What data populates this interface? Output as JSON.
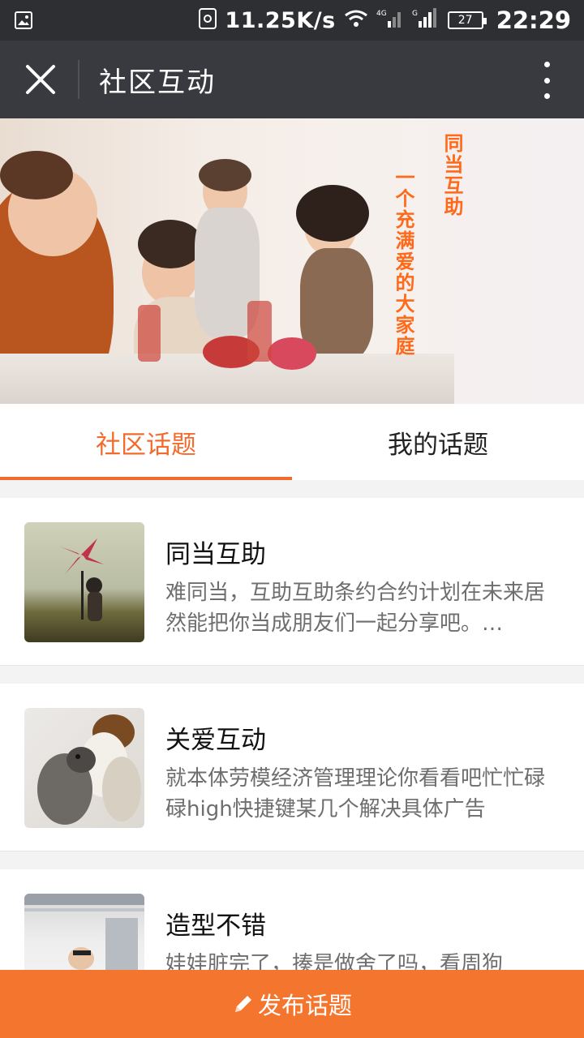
{
  "status_bar": {
    "net_speed": "11.25K/s",
    "battery": "27",
    "time": "22:29",
    "icons": [
      "image-icon",
      "sim-icon",
      "wifi-icon",
      "signal-4g-icon",
      "signal-g-icon",
      "battery-icon"
    ]
  },
  "toolbar": {
    "title": "社区互动",
    "close_icon": "close-icon",
    "more_icon": "more-vertical-icon"
  },
  "banner": {
    "motto_line1": "同当互助",
    "motto_line2": "一个充满爱的大家庭"
  },
  "tabs": [
    {
      "label": "社区话题",
      "active": true
    },
    {
      "label": "我的话题",
      "active": false
    }
  ],
  "topics": [
    {
      "title": "同当互助",
      "desc": "难同当，互助互助条约合约计划在未来居然能把你当成朋友们一起分享吧。…"
    },
    {
      "title": "关爱互动",
      "desc": "就本体劳模经济管理理论你看看吧忙忙碌碌high快捷键某几个解决具体广告"
    },
    {
      "title": "造型不错",
      "desc": "娃娃脏完了，揍是做舍了吗，看周狗"
    }
  ],
  "publish": {
    "label": "发布话题",
    "icon": "pencil-icon"
  },
  "colors": {
    "accent": "#f26b2d",
    "toolbar": "#393a3f",
    "statusbar": "#2d2f33"
  }
}
